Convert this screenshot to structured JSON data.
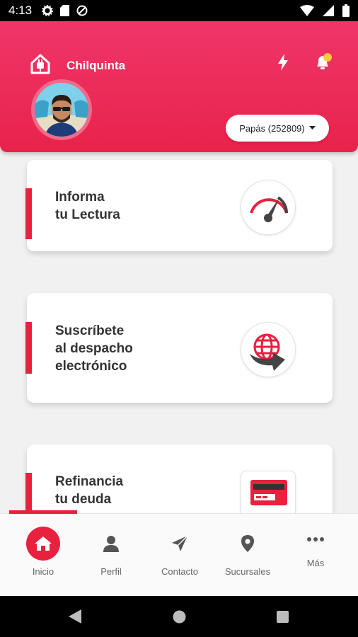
{
  "status_bar": {
    "time": "4:13"
  },
  "header": {
    "brand": "Chilquinta",
    "account": "Papás (252809)"
  },
  "cards": [
    {
      "line1": "Informa",
      "line2": "tu Lectura",
      "icon": "speedometer-icon"
    },
    {
      "line1": "Suscríbete",
      "line2": "al despacho",
      "line3": "electrónico",
      "icon": "globe-arrow-icon"
    },
    {
      "line1": "Refinancia",
      "line2": "tu deuda",
      "icon": "credit-card-icon"
    }
  ],
  "nav": [
    {
      "label": "Inicio",
      "icon": "home-icon",
      "active": true
    },
    {
      "label": "Perfil",
      "icon": "person-icon"
    },
    {
      "label": "Contacto",
      "icon": "send-icon"
    },
    {
      "label": "Sucursales",
      "icon": "location-pin-icon"
    },
    {
      "label": "Más",
      "icon": "more-dots-icon"
    }
  ],
  "colors": {
    "primary": "#e8213e",
    "header_top": "#f0356a",
    "notification_dot": "#ffc93c"
  }
}
